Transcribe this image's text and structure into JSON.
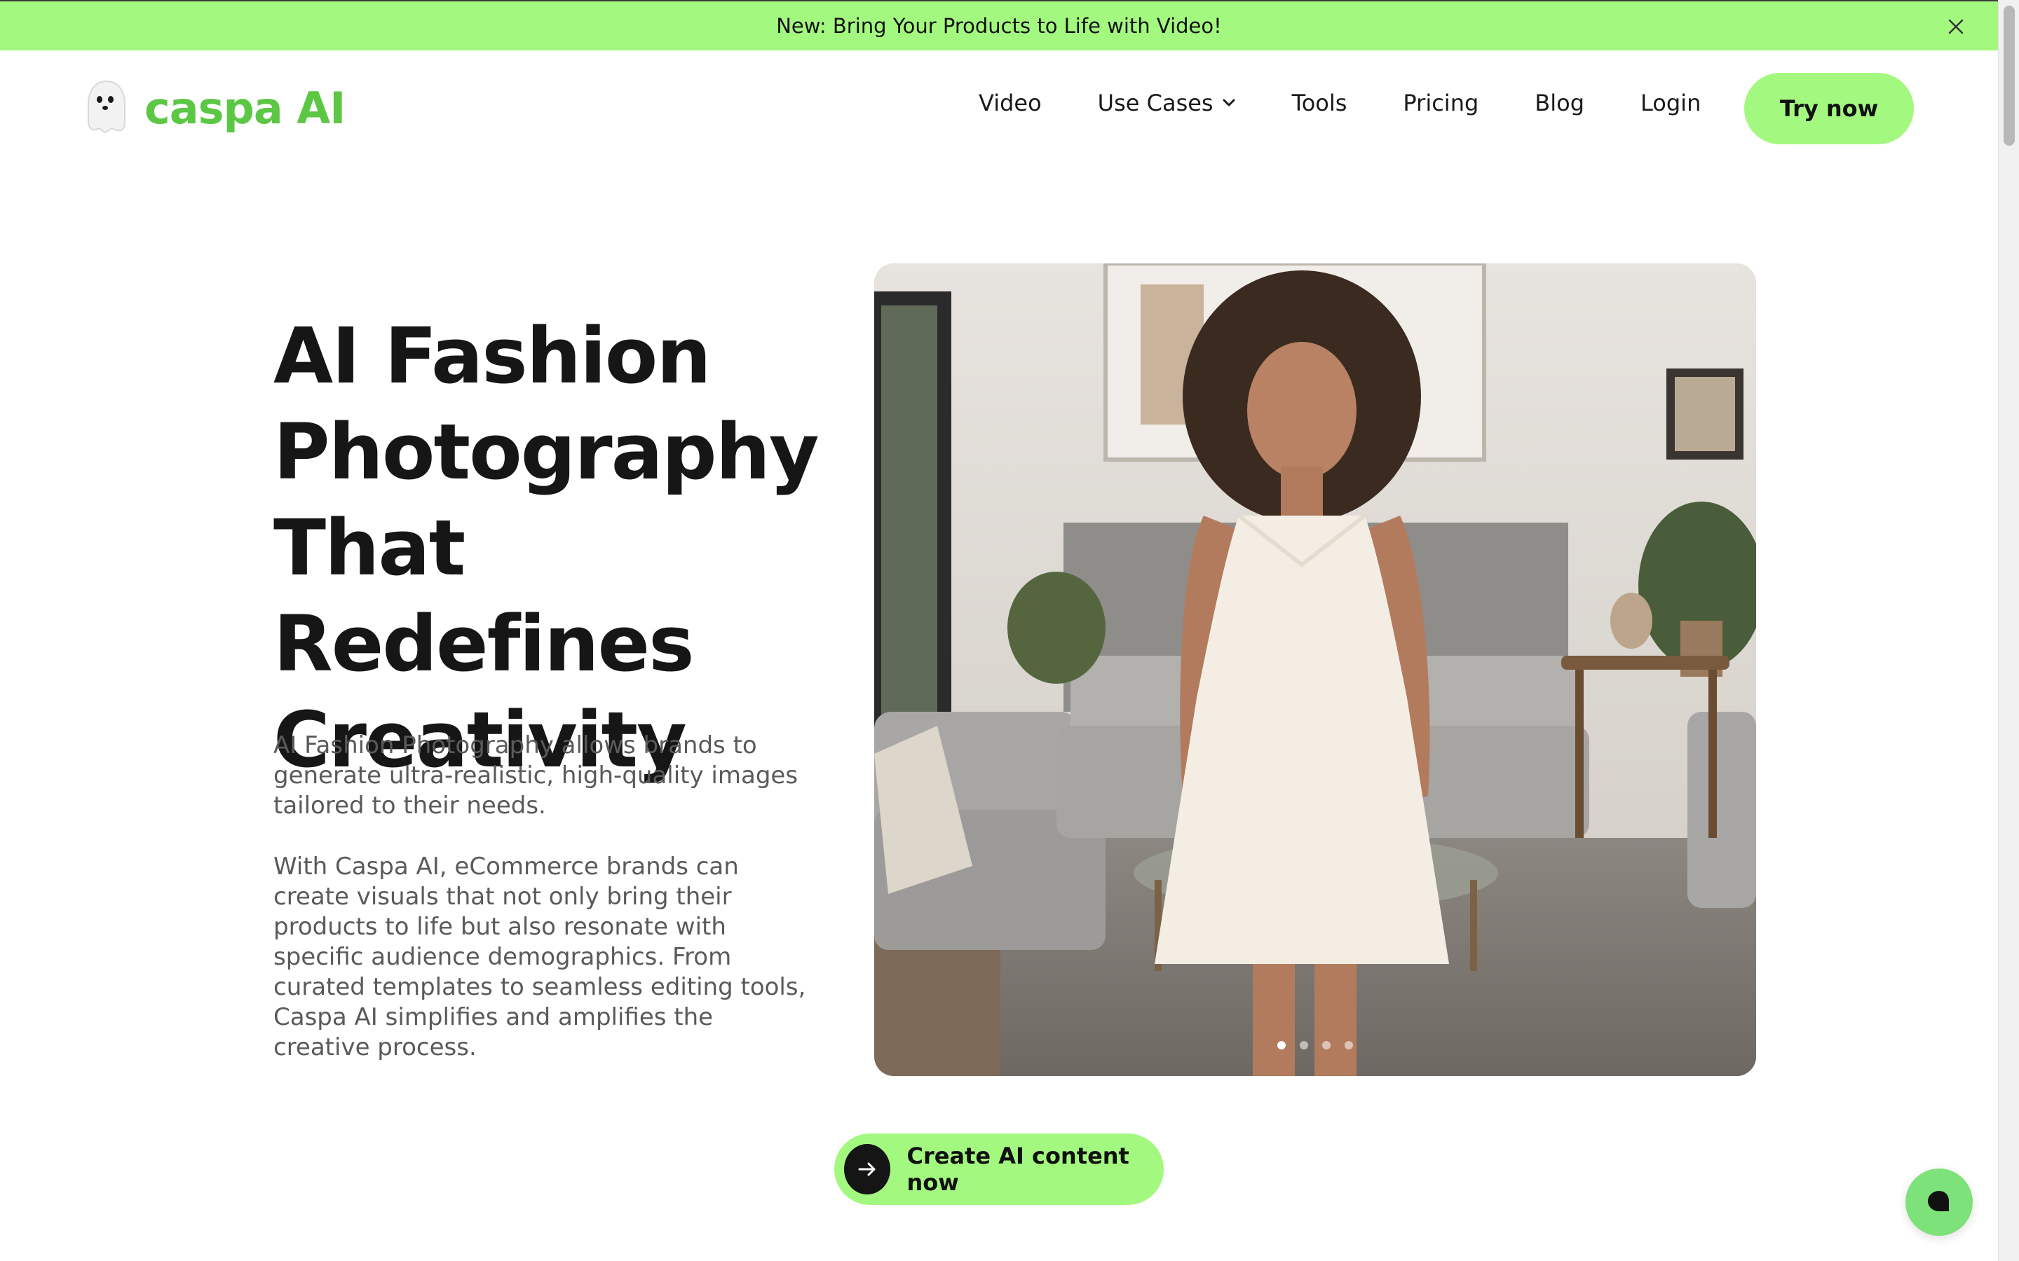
{
  "banner": {
    "text": "New: Bring Your Products to Life with Video!",
    "close_icon": "close-icon"
  },
  "header": {
    "logo_text": "caspa AI",
    "logo_icon": "ghost-icon",
    "nav": {
      "video": "Video",
      "use_cases": "Use Cases",
      "tools": "Tools",
      "pricing": "Pricing",
      "blog": "Blog",
      "login": "Login"
    },
    "cta": "Try now"
  },
  "hero": {
    "title_lines": [
      "AI Fashion",
      "Photography",
      "That Redefines",
      "Creativity"
    ],
    "paragraph_1": "AI Fashion Photography allows brands to generate ultra-realistic, high-quality images tailored to their needs.",
    "paragraph_2": "With Caspa AI, eCommerce brands can create visuals that not only bring their products to life but also resonate with specific audience demographics. From curated templates to seamless editing tools, Caspa AI simplifies and amplifies the creative process.",
    "carousel": {
      "slides": 4,
      "active": 1
    },
    "cta": "Create AI content now"
  },
  "colors": {
    "accent": "#a3f97f",
    "brand": "#5cc744",
    "text": "#161616",
    "muted": "#5a5a5a"
  }
}
